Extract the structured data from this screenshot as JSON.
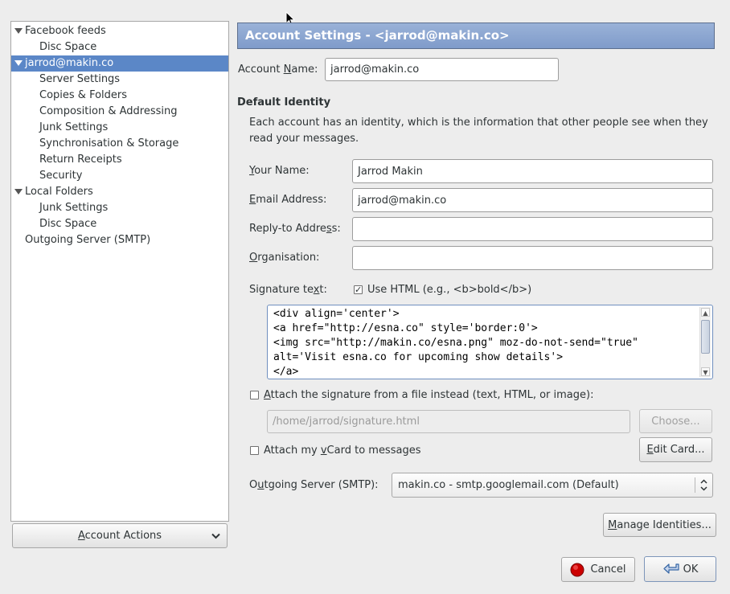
{
  "tree": {
    "items": [
      {
        "label": "Facebook feeds",
        "level": 0,
        "expanded": true,
        "selected": false
      },
      {
        "label": "Disc Space",
        "level": 1,
        "selected": false
      },
      {
        "label": "jarrod@makin.co",
        "level": 0,
        "expanded": true,
        "selected": true
      },
      {
        "label": "Server Settings",
        "level": 1,
        "selected": false
      },
      {
        "label": "Copies & Folders",
        "level": 1,
        "selected": false
      },
      {
        "label": "Composition & Addressing",
        "level": 1,
        "selected": false
      },
      {
        "label": "Junk Settings",
        "level": 1,
        "selected": false
      },
      {
        "label": "Synchronisation & Storage",
        "level": 1,
        "selected": false
      },
      {
        "label": "Return Receipts",
        "level": 1,
        "selected": false
      },
      {
        "label": "Security",
        "level": 1,
        "selected": false
      },
      {
        "label": "Local Folders",
        "level": 0,
        "expanded": true,
        "selected": false
      },
      {
        "label": "Junk Settings",
        "level": 1,
        "selected": false
      },
      {
        "label": "Disc Space",
        "level": 1,
        "selected": false
      },
      {
        "label": "Outgoing Server (SMTP)",
        "level": 0,
        "selected": false
      }
    ]
  },
  "account_actions": {
    "label": "Account Actions",
    "icon": "chevron-down-icon"
  },
  "header": {
    "title": "Account Settings - <jarrod@makin.co>"
  },
  "account_name": {
    "label": "Account Name:",
    "value": "jarrod@makin.co"
  },
  "default_identity": {
    "heading": "Default Identity",
    "description_line1": "Each account has an identity, which is the information that other people see when they",
    "description_line2": "read your messages."
  },
  "your_name": {
    "label": "Your Name:",
    "value": "Jarrod Makin"
  },
  "email": {
    "label": "Email Address:",
    "value": "jarrod@makin.co"
  },
  "reply_to": {
    "label": "Reply-to Address:",
    "value": ""
  },
  "organisation": {
    "label": "Organisation:",
    "value": ""
  },
  "signature": {
    "label": "Signature text:",
    "use_html_label": "Use HTML (e.g., <b>bold</b>)",
    "use_html_checked": true,
    "text": "<div align='center'>\n<a href=\"http://esna.co\" style='border:0'>\n<img src=\"http://makin.co/esna.png\" moz-do-not-send=\"true\"\nalt='Visit esna.co for upcoming show details'>\n</a>"
  },
  "attach_file": {
    "label": "Attach the signature from a file instead (text, HTML, or image):",
    "checked": false,
    "path_placeholder": "/home/jarrod/signature.html",
    "choose_label": "Choose..."
  },
  "vcard": {
    "label": "Attach my vCard to messages",
    "checked": false,
    "edit_label": "Edit Card..."
  },
  "smtp": {
    "label": "Outgoing Server (SMTP):",
    "value": "makin.co - smtp.googlemail.com (Default)"
  },
  "manage_identities": {
    "label": "Manage Identities..."
  },
  "cancel": {
    "label": "Cancel",
    "icon": "cancel-icon"
  },
  "ok": {
    "label": "OK",
    "icon": "ok-arrow-icon"
  }
}
